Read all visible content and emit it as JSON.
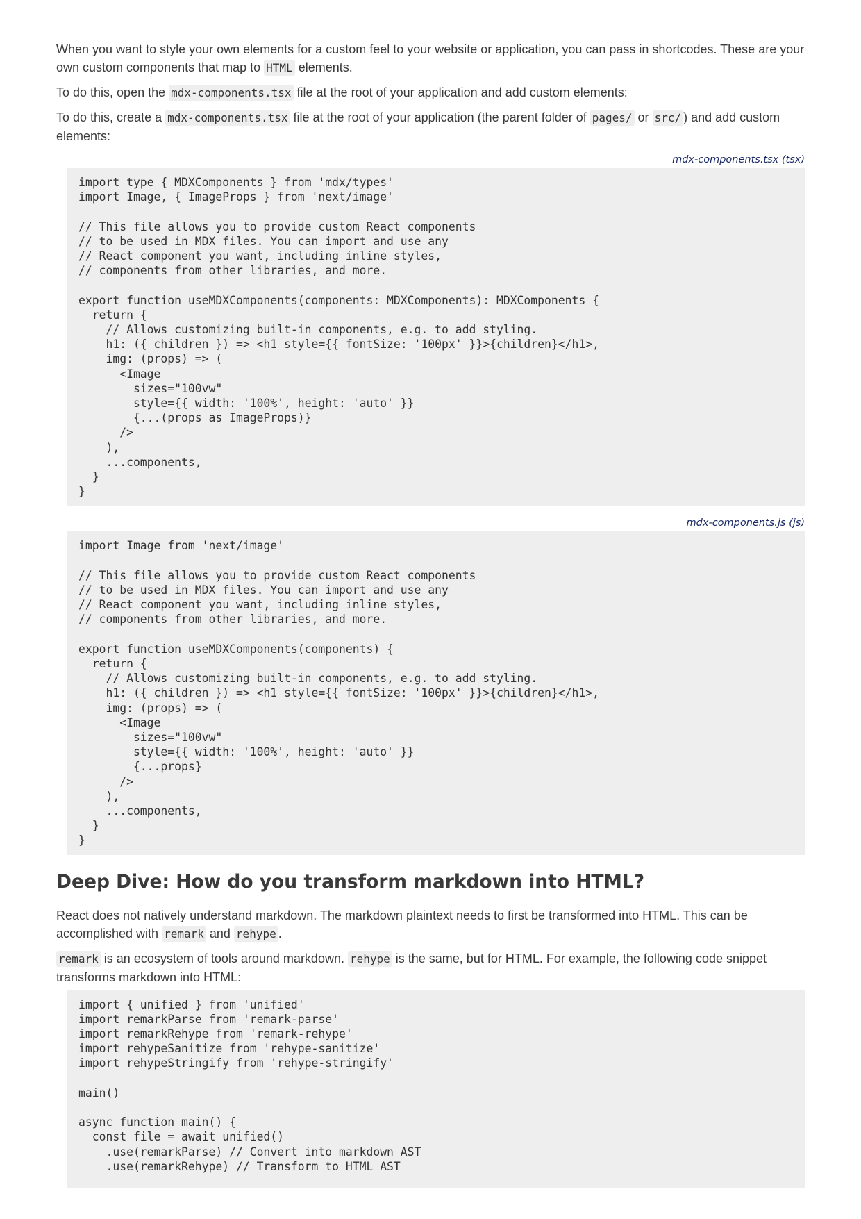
{
  "intro": {
    "p1": {
      "before": "When you want to style your own elements for a custom feel to your website or application, you can pass in shortcodes. These are your own custom components that map to ",
      "code": "HTML",
      "after": " elements."
    },
    "p2": {
      "before": "To do this, open the ",
      "code": "mdx-components.tsx",
      "after": " file at the root of your application and add custom elements:"
    },
    "p3": {
      "before": "To do this, create a ",
      "code1": "mdx-components.tsx",
      "mid1": " file at the root of your application (the parent folder of ",
      "code2": "pages/",
      "mid2": " or ",
      "code3": "src/",
      "after": ") and add custom elements:"
    }
  },
  "code_blocks": [
    {
      "caption": "mdx-components.tsx (tsx)",
      "lines": [
        "import type { MDXComponents } from 'mdx/types'",
        "import Image, { ImageProps } from 'next/image'",
        "",
        "// This file allows you to provide custom React components",
        "// to be used in MDX files. You can import and use any",
        "// React component you want, including inline styles,",
        "// components from other libraries, and more.",
        "",
        "export function useMDXComponents(components: MDXComponents): MDXComponents {",
        "  return {",
        "    // Allows customizing built-in components, e.g. to add styling.",
        "    h1: ({ children }) => <h1 style={{ fontSize: '100px' }}>{children}</h1>,",
        "    img: (props) => (",
        "      <Image",
        "        sizes=\"100vw\"",
        "        style={{ width: '100%', height: 'auto' }}",
        "        {...(props as ImageProps)}",
        "      />",
        "    ),",
        "    ...components,",
        "  }",
        "}"
      ]
    },
    {
      "caption": "mdx-components.js (js)",
      "lines": [
        "import Image from 'next/image'",
        "",
        "// This file allows you to provide custom React components",
        "// to be used in MDX files. You can import and use any",
        "// React component you want, including inline styles,",
        "// components from other libraries, and more.",
        "",
        "export function useMDXComponents(components) {",
        "  return {",
        "    // Allows customizing built-in components, e.g. to add styling.",
        "    h1: ({ children }) => <h1 style={{ fontSize: '100px' }}>{children}</h1>,",
        "    img: (props) => (",
        "      <Image",
        "        sizes=\"100vw\"",
        "        style={{ width: '100%', height: 'auto' }}",
        "        {...props}",
        "      />",
        "    ),",
        "    ...components,",
        "  }",
        "}"
      ]
    }
  ],
  "deep_dive": {
    "heading": "Deep Dive: How do you transform markdown into HTML?",
    "p1": {
      "before": "React does not natively understand markdown. The markdown plaintext needs to first be transformed into HTML. This can be accomplished with ",
      "code1": "remark",
      "mid": " and ",
      "code2": "rehype",
      "after": "."
    },
    "p2": {
      "code1": "remark",
      "mid": " is an ecosystem of tools around markdown. ",
      "code2": "rehype",
      "after": " is the same, but for HTML. For example, the following code snippet transforms markdown into HTML:"
    },
    "code": {
      "lines": [
        "import { unified } from 'unified'",
        "import remarkParse from 'remark-parse'",
        "import remarkRehype from 'remark-rehype'",
        "import rehypeSanitize from 'rehype-sanitize'",
        "import rehypeStringify from 'rehype-stringify'",
        "",
        "main()",
        "",
        "async function main() {",
        "  const file = await unified()",
        "    .use(remarkParse) // Convert into markdown AST",
        "    .use(remarkRehype) // Transform to HTML AST"
      ]
    }
  },
  "colors": {
    "caption": "#1a2a66",
    "code_background": "#eeeeee",
    "body_text": "#3a3a3a"
  }
}
